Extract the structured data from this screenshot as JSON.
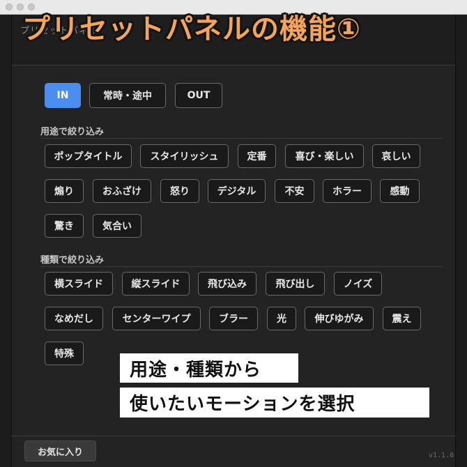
{
  "window": {
    "tab_label": "プリセットパネル"
  },
  "overlay": {
    "title": "プリセットパネルの機能①",
    "callout_line1": "用途・種類から",
    "callout_line2": "使いたいモーションを選択"
  },
  "timing_tabs": [
    {
      "label": "IN",
      "active": true
    },
    {
      "label": "常時・途中",
      "active": false
    },
    {
      "label": "OUT",
      "active": false
    }
  ],
  "usage_section": {
    "title": "用途で絞り込み",
    "tags": [
      "ポップタイトル",
      "スタイリッシュ",
      "定番",
      "喜び・楽しい",
      "哀しい",
      "煽り",
      "おふざけ",
      "怒り",
      "デジタル",
      "不安",
      "ホラー",
      "感動",
      "驚き",
      "気合い"
    ]
  },
  "type_section": {
    "title": "種類で絞り込み",
    "tags": [
      "横スライド",
      "縦スライド",
      "飛び込み",
      "飛び出し",
      "ノイズ",
      "なめだし",
      "センターワイプ",
      "ブラー",
      "光",
      "伸びゆがみ",
      "震え",
      "特殊"
    ]
  },
  "footer": {
    "favorites_label": "お気に入り",
    "version": "v1.1.0"
  },
  "colors": {
    "accent": "#4a8ff0",
    "title_orange": "#f5a55a",
    "panel_bg": "#232323"
  }
}
